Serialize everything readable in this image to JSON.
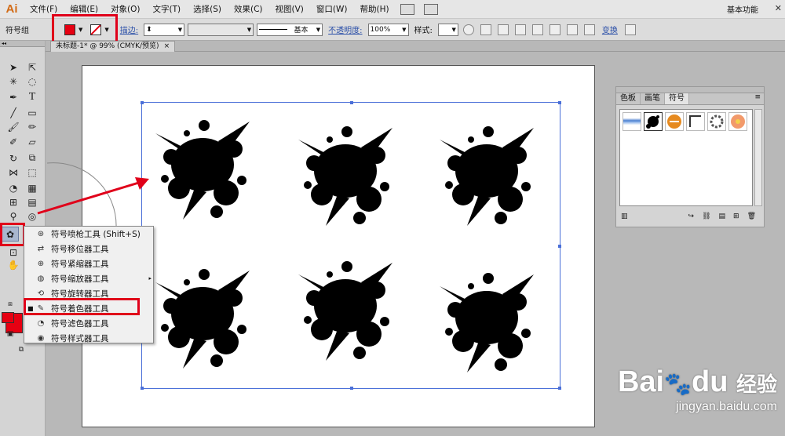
{
  "app": {
    "logo": "Ai",
    "workspace": "基本功能"
  },
  "menu": [
    "文件(F)",
    "编辑(E)",
    "对象(O)",
    "文字(T)",
    "选择(S)",
    "效果(C)",
    "视图(V)",
    "窗口(W)",
    "帮助(H)"
  ],
  "options": {
    "group_label": "符号组",
    "stroke_label": "描边:",
    "stroke_style": "基本",
    "opacity_label": "不透明度:",
    "opacity_value": "100%",
    "style_label": "样式:",
    "transform_label": "变换"
  },
  "document": {
    "tab_title": "未标题-1* @ 99% (CMYK/预览)",
    "close": "×"
  },
  "flyout": {
    "items": [
      {
        "label": "符号喷枪工具  (Shift+S)",
        "icon": "sprayer-icon"
      },
      {
        "label": "符号移位器工具",
        "icon": "shifter-icon"
      },
      {
        "label": "符号紧缩器工具",
        "icon": "scruncher-icon"
      },
      {
        "label": "符号缩放器工具",
        "icon": "sizer-icon"
      },
      {
        "label": "符号旋转器工具",
        "icon": "spinner-icon"
      },
      {
        "label": "符号着色器工具",
        "icon": "stainer-icon",
        "selected": true
      },
      {
        "label": "符号滤色器工具",
        "icon": "screener-icon"
      },
      {
        "label": "符号样式器工具",
        "icon": "styler-icon"
      }
    ]
  },
  "panel": {
    "tabs": [
      "色板",
      "画笔",
      "符号"
    ],
    "active_tab": "符号"
  },
  "colors": {
    "fill": "#e60012",
    "highlight": "#e0001a",
    "selection": "#4a6fd8"
  },
  "watermark": {
    "brand": "Bai",
    "brand2": "du",
    "cn": "经验",
    "url": "jingyan.baidu.com"
  }
}
